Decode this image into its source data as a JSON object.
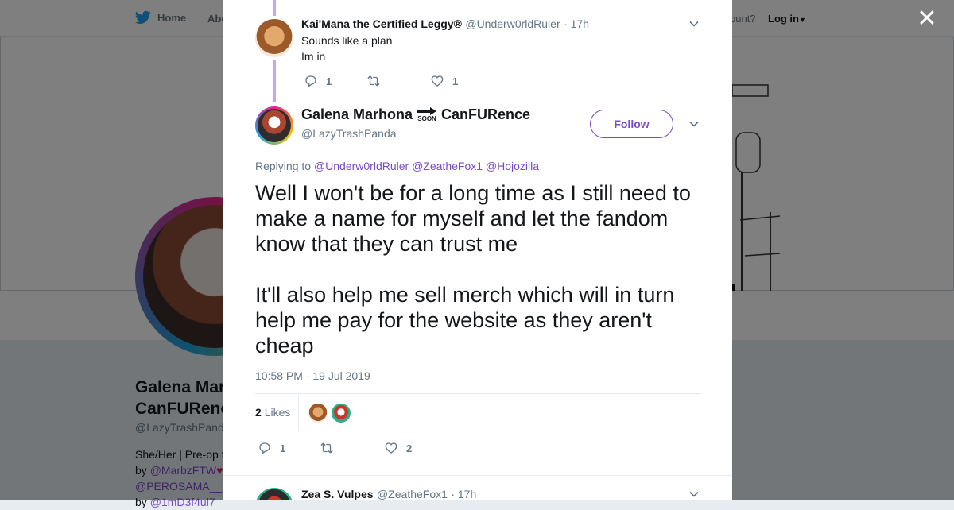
{
  "nav": {
    "home_label": "Home",
    "about_label": "Abo",
    "account_prompt": "ccount?",
    "login_label": "Log in"
  },
  "profile": {
    "name_line1": "Galena Mar",
    "name_line2": "CanFURenc",
    "handle": "@LazyTrashPand",
    "bio_line1": "She/Her | Pre-op t",
    "bio_by1": "by",
    "bio_link1": "@MarbzFTW",
    "bio_link2": "@PEROSAMA__",
    "bio_by2": "by",
    "bio_link3": "@1mD3f4ul7"
  },
  "modal": {
    "parent_tweet": {
      "name": "Kai'Mana the Certified Leggy®",
      "handle": "@Underw0rldRuler",
      "time": "· 17h",
      "text_line1": "Sounds like a plan",
      "text_line2": "Im in",
      "reply_count": "1",
      "retweet_count": "",
      "like_count": "1"
    },
    "main_tweet": {
      "name_part1": "Galena Marhona",
      "soon_badge": "SOON",
      "name_part2": "CanFURence",
      "handle": "@LazyTrashPanda",
      "follow_label": "Follow",
      "replying_to_label": "Replying to",
      "replying_to": [
        "@Underw0rldRuler",
        "@ZeatheFox1",
        "@Hojozilla"
      ],
      "text": "Well I won't be for a long time as I still need to make a name for myself and let the fandom know that they can trust me\n\nIt'll also help me sell merch which will in turn help me pay for the website as they aren't cheap",
      "timestamp": "10:58 PM - 19 Jul 2019",
      "likes_count": "2",
      "likes_label": "Likes",
      "reply_count": "1",
      "retweet_count": "",
      "like_count": "2"
    },
    "next_tweet": {
      "name": "Zea S. Vulpes",
      "handle": "@ZeatheFox1",
      "time": "· 17h"
    }
  },
  "colors": {
    "accent": "#794bc4",
    "thread_line": "#c8a6ef",
    "twitter_blue": "#1da1f2",
    "muted_text": "#657786"
  },
  "icons": [
    "twitter-bird-icon",
    "caret-down-icon",
    "close-icon",
    "chevron-down-icon",
    "reply-icon",
    "retweet-icon",
    "heart-icon",
    "soon-arrow-icon"
  ]
}
